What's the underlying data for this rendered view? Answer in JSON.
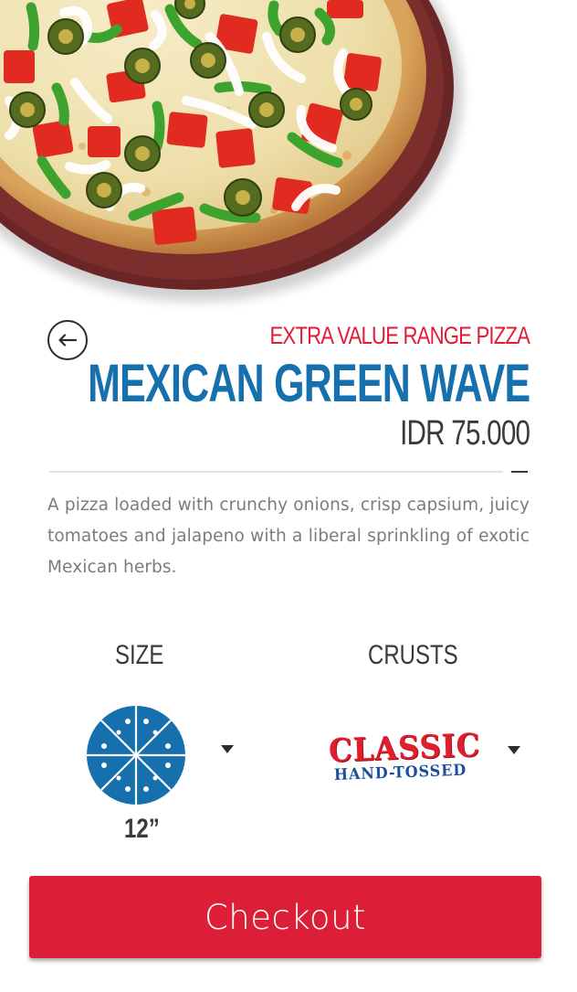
{
  "product": {
    "category": "EXTRA VALUE RANGE PIZZA",
    "name": "MEXICAN GREEN WAVE",
    "price": "IDR 75.000",
    "description": "A pizza loaded with crunchy onions, crisp capsium, juicy tomatoes and jalapeno with a liberal sprinkling of exotic Mexican herbs."
  },
  "options": {
    "size_label": "SIZE",
    "size_value": "12”",
    "crusts_label": "CRUSTS",
    "crust_value_main": "CLASSIC",
    "crust_value_sub": "HAND-TOSSED"
  },
  "actions": {
    "checkout_label": "Checkout"
  },
  "icons": {
    "back": "arrow-left-icon",
    "size": "pizza-slices-icon",
    "dropdown": "caret-down-icon"
  },
  "colors": {
    "brand_red": "#dc1f36",
    "brand_blue": "#1670ae",
    "text_dark": "#3a3a3a",
    "text_muted": "#7b7b7b"
  }
}
